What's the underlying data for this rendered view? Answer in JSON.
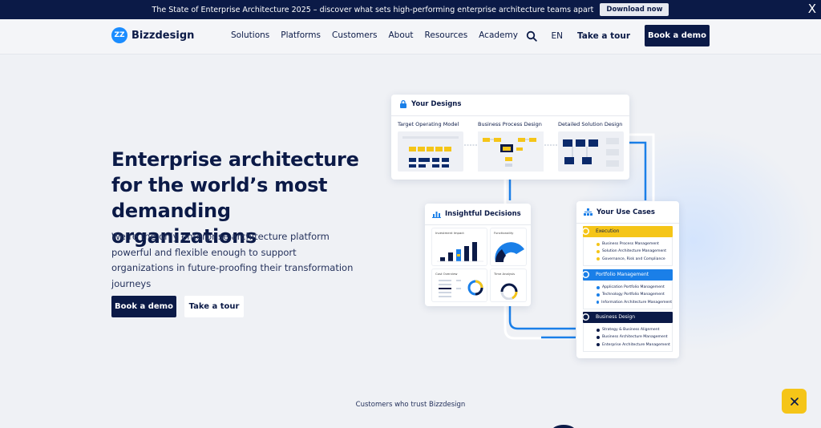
{
  "banner": {
    "text": "The State of Enterprise Architecture 2025 – discover what sets high-performing enterprise architecture teams apart",
    "cta": "Download now",
    "close": "X"
  },
  "nav": {
    "logo_mark": "ZZ",
    "logo_text": "Bizzdesign",
    "menu": [
      "Solutions",
      "Platforms",
      "Customers",
      "About",
      "Resources",
      "Academy"
    ],
    "language": "EN",
    "tour": "Take a tour",
    "demo": "Book a demo"
  },
  "hero": {
    "title": "Enterprise architecture for the world’s most demanding organizations",
    "subtitle": "We’re the only enterprise architecture platform powerful and flexible enough to support organizations in future-proofing their transformation journeys",
    "primary_cta": "Book a demo",
    "secondary_cta": "Take a tour"
  },
  "designs_card": {
    "title": "Your Designs",
    "columns": [
      "Target Operating Model",
      "Business Process Design",
      "Detailed Solution Design"
    ]
  },
  "insights_card": {
    "title": "Insightful Decisions",
    "panels": [
      "Investment Impact",
      "Functionality",
      "Cost Overview",
      "Time Analysis"
    ]
  },
  "usecases_card": {
    "title": "Your Use Cases",
    "groups": [
      {
        "name": "Execution",
        "color": "#f5c518",
        "items": [
          "Business Process Management",
          "Solution Architecture Management",
          "Governance, Risk and Compliance"
        ]
      },
      {
        "name": "Portfolio Management",
        "color": "#1a7fe8",
        "items": [
          "Application Portfolio Management",
          "Technology Portfolio Management",
          "Information Architecture Management"
        ]
      },
      {
        "name": "Business Design",
        "color": "#0b1a47",
        "items": [
          "Strategy & Business Alignment",
          "Business Architecture Management",
          "Enterprise Architecture Management"
        ]
      }
    ]
  },
  "trust": "Customers who trust Bizzdesign",
  "colors": {
    "navy": "#0b1a47",
    "blue": "#1a8cff",
    "yellow": "#f5c518"
  }
}
